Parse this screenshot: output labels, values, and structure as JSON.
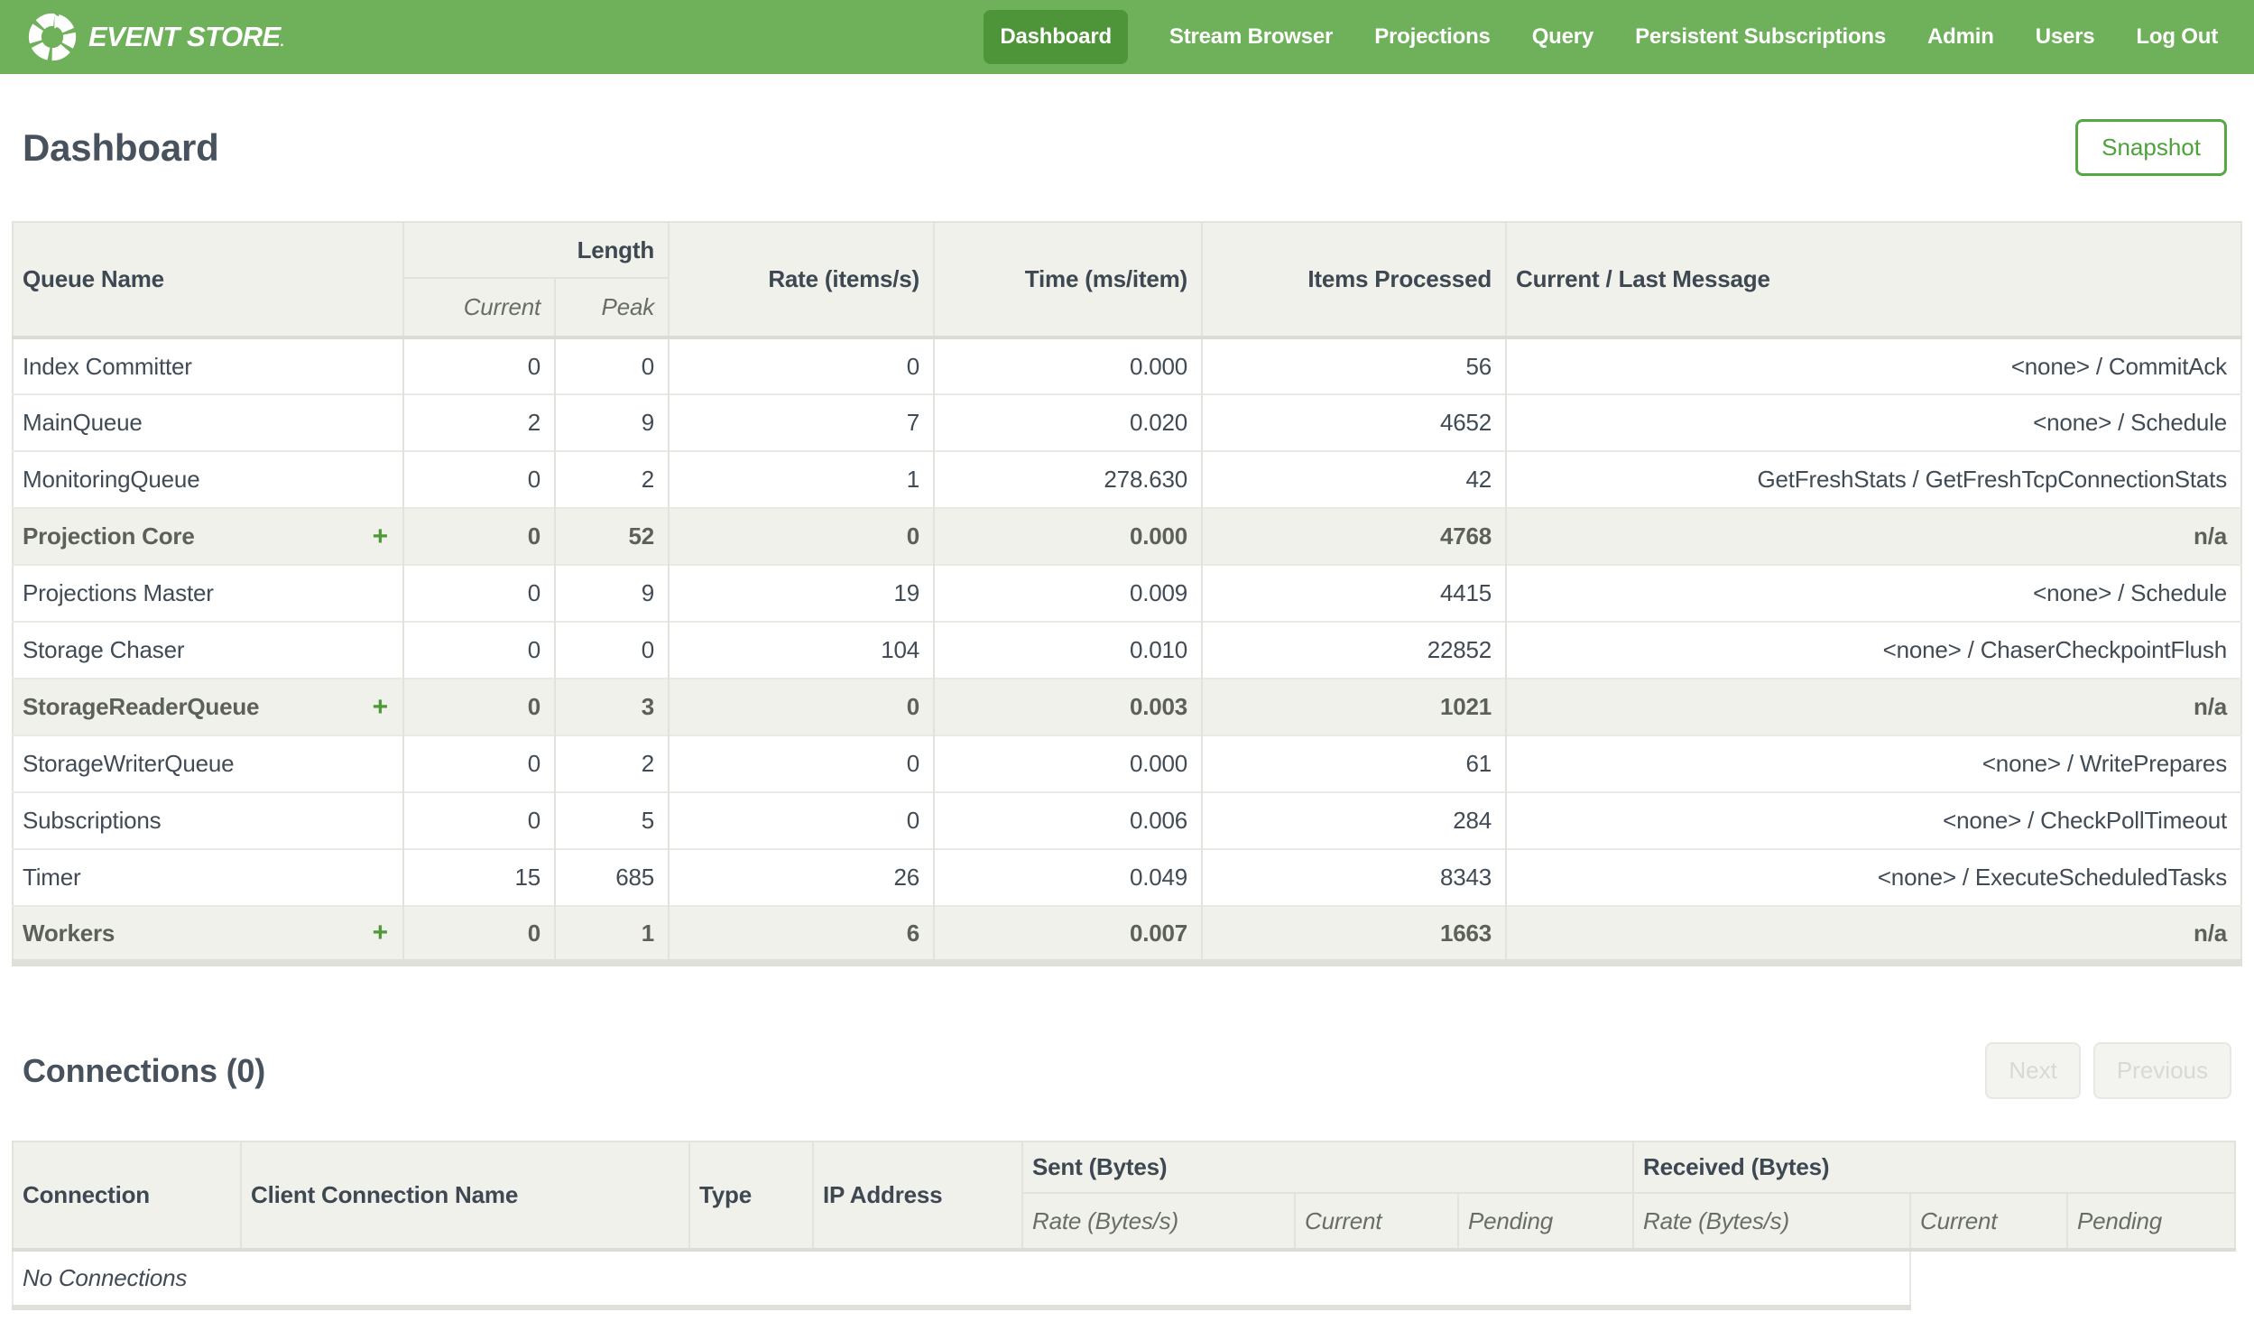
{
  "colors": {
    "navbar_green": "#6FB05A",
    "navbar_active_green": "#4E9438",
    "accent_green": "#57A744",
    "plus_green": "#4E9A39",
    "header_row_bg": "#F0F1EB",
    "body_text": "#414B55",
    "heading_text": "#47525C",
    "disabled_text": "#D8D9D3"
  },
  "navbar": {
    "logo_icon": "circular-arrows-logo-icon",
    "logo_text": "EVENT STORE",
    "logo_suffix": ".",
    "items": [
      {
        "label": "Dashboard",
        "active": true
      },
      {
        "label": "Stream Browser",
        "active": false
      },
      {
        "label": "Projections",
        "active": false
      },
      {
        "label": "Query",
        "active": false
      },
      {
        "label": "Persistent Subscriptions",
        "active": false
      },
      {
        "label": "Admin",
        "active": false
      },
      {
        "label": "Users",
        "active": false
      },
      {
        "label": "Log Out",
        "active": false
      }
    ]
  },
  "page": {
    "title": "Dashboard",
    "snapshot_button": "Snapshot"
  },
  "queues": {
    "expand_symbol": "+",
    "headers": {
      "queue_name": "Queue Name",
      "length": "Length",
      "current": "Current",
      "peak": "Peak",
      "rate": "Rate (items/s)",
      "time": "Time (ms/item)",
      "items_processed": "Items Processed",
      "message": "Current / Last Message"
    },
    "rows": [
      {
        "name": "Index Committer",
        "expandable": false,
        "summary": false,
        "current": "0",
        "peak": "0",
        "rate": "0",
        "time": "0.000",
        "items": "56",
        "message": "<none> / CommitAck"
      },
      {
        "name": "MainQueue",
        "expandable": false,
        "summary": false,
        "current": "2",
        "peak": "9",
        "rate": "7",
        "time": "0.020",
        "items": "4652",
        "message": "<none> / Schedule"
      },
      {
        "name": "MonitoringQueue",
        "expandable": false,
        "summary": false,
        "current": "0",
        "peak": "2",
        "rate": "1",
        "time": "278.630",
        "items": "42",
        "message": "GetFreshStats / GetFreshTcpConnectionStats"
      },
      {
        "name": "Projection Core",
        "expandable": true,
        "summary": true,
        "current": "0",
        "peak": "52",
        "rate": "0",
        "time": "0.000",
        "items": "4768",
        "message": "n/a"
      },
      {
        "name": "Projections Master",
        "expandable": false,
        "summary": false,
        "current": "0",
        "peak": "9",
        "rate": "19",
        "time": "0.009",
        "items": "4415",
        "message": "<none> / Schedule"
      },
      {
        "name": "Storage Chaser",
        "expandable": false,
        "summary": false,
        "current": "0",
        "peak": "0",
        "rate": "104",
        "time": "0.010",
        "items": "22852",
        "message": "<none> / ChaserCheckpointFlush"
      },
      {
        "name": "StorageReaderQueue",
        "expandable": true,
        "summary": true,
        "current": "0",
        "peak": "3",
        "rate": "0",
        "time": "0.003",
        "items": "1021",
        "message": "n/a"
      },
      {
        "name": "StorageWriterQueue",
        "expandable": false,
        "summary": false,
        "current": "0",
        "peak": "2",
        "rate": "0",
        "time": "0.000",
        "items": "61",
        "message": "<none> / WritePrepares"
      },
      {
        "name": "Subscriptions",
        "expandable": false,
        "summary": false,
        "current": "0",
        "peak": "5",
        "rate": "0",
        "time": "0.006",
        "items": "284",
        "message": "<none> / CheckPollTimeout"
      },
      {
        "name": "Timer",
        "expandable": false,
        "summary": false,
        "current": "15",
        "peak": "685",
        "rate": "26",
        "time": "0.049",
        "items": "8343",
        "message": "<none> / ExecuteScheduledTasks"
      },
      {
        "name": "Workers",
        "expandable": true,
        "summary": true,
        "current": "0",
        "peak": "1",
        "rate": "6",
        "time": "0.007",
        "items": "1663",
        "message": "n/a"
      }
    ]
  },
  "connections": {
    "title": "Connections (0)",
    "next_button": "Next",
    "previous_button": "Previous",
    "headers": {
      "connection": "Connection",
      "client": "Client Connection Name",
      "type": "Type",
      "ip": "IP Address",
      "sent": "Sent (Bytes)",
      "received": "Received (Bytes)",
      "rate": "Rate (Bytes/s)",
      "current": "Current",
      "pending": "Pending"
    },
    "empty_message": "No Connections"
  }
}
